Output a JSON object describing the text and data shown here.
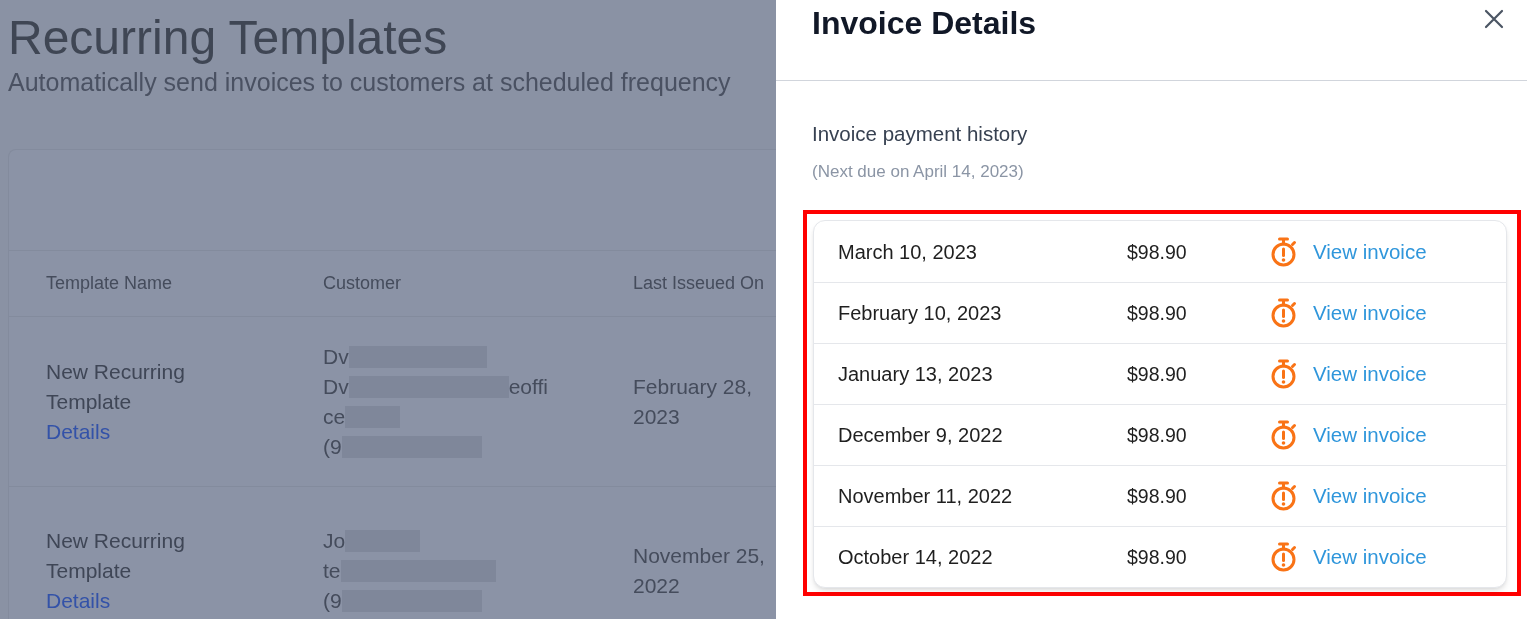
{
  "background_page": {
    "title": "Recurring Templates",
    "subtitle": "Automatically send invoices to customers at scheduled frequency",
    "table": {
      "columns": [
        "Template Name",
        "Customer",
        "Last Isseued On"
      ],
      "rows": [
        {
          "template_name": "New Recurring Template",
          "link": "Details",
          "customer_lines": [
            {
              "text": "Dv",
              "redacted": true
            },
            {
              "text": "Dv",
              "redacted": true,
              "after": "eoffi"
            },
            {
              "text": "ce",
              "redacted": true
            },
            {
              "text": "(9",
              "redacted": true
            }
          ],
          "last_issued_on": "February 28, 2023"
        },
        {
          "template_name": "New Recurring Template",
          "link": "Details",
          "customer_lines": [
            {
              "text": "Jo",
              "redacted": true
            },
            {
              "text": "te",
              "redacted": true
            },
            {
              "text": "(9",
              "redacted": true
            }
          ],
          "last_issued_on": "November 25, 2022"
        }
      ]
    }
  },
  "panel": {
    "title": "Invoice Details",
    "section_title": "Invoice payment history",
    "next_due": "(Next due on April 14, 2023)",
    "highlighted": true,
    "payments": [
      {
        "date": "March 10, 2023",
        "amount": "$98.90",
        "link": "View invoice"
      },
      {
        "date": "February 10, 2023",
        "amount": "$98.90",
        "link": "View invoice"
      },
      {
        "date": "January 13, 2023",
        "amount": "$98.90",
        "link": "View invoice"
      },
      {
        "date": "December 9, 2022",
        "amount": "$98.90",
        "link": "View invoice"
      },
      {
        "date": "November 11, 2022",
        "amount": "$98.90",
        "link": "View invoice"
      },
      {
        "date": "October 14, 2022",
        "amount": "$98.90",
        "link": "View invoice"
      }
    ]
  }
}
